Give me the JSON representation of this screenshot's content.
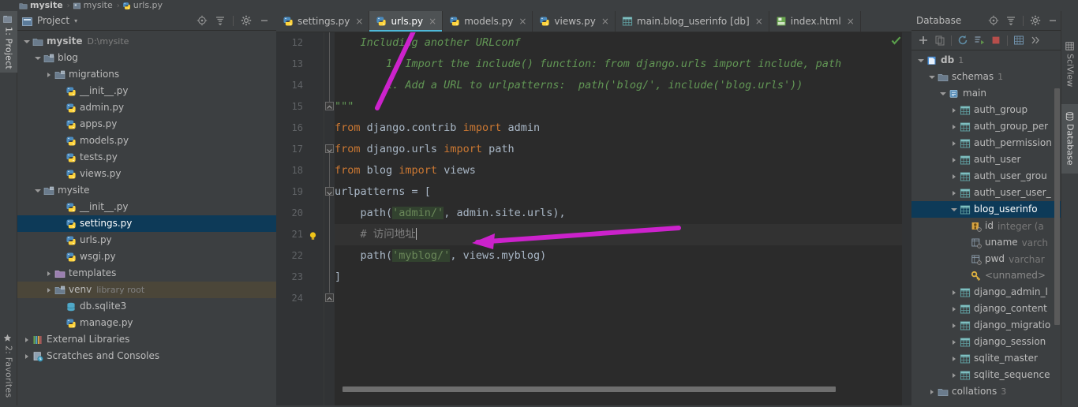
{
  "breadcrumb": {
    "items": [
      {
        "label": "mysite",
        "icon": "folder-icon",
        "bold": true
      },
      {
        "label": "mysite",
        "icon": "module-icon",
        "bold": false
      },
      {
        "label": "urls.py",
        "icon": "python-file-icon",
        "bold": false
      }
    ]
  },
  "left_strip": {
    "tabs": [
      {
        "label": "1: Project",
        "icon": "project-icon",
        "active": true
      },
      {
        "label": "2: Favorites",
        "icon": "star-icon",
        "active": false
      }
    ]
  },
  "right_strip": {
    "tabs": [
      {
        "label": "SciView",
        "icon": "sciview-icon",
        "active": false
      },
      {
        "label": "Database",
        "icon": "database-icon",
        "active": true
      }
    ]
  },
  "project_panel": {
    "title": "Project",
    "dropdown_caret": "▾",
    "tools": [
      "locate-icon",
      "collapse-all-icon",
      "gear-icon",
      "minimize-icon"
    ],
    "tree": [
      {
        "label": "mysite",
        "sub": "D:\\mysite",
        "icon": "folder-icon",
        "indent": 0,
        "arrow": "open",
        "bold": true,
        "state": "normal"
      },
      {
        "label": "blog",
        "sub": "",
        "icon": "module-folder-icon",
        "indent": 1,
        "arrow": "open",
        "bold": false,
        "state": "normal"
      },
      {
        "label": "migrations",
        "sub": "",
        "icon": "module-folder-icon",
        "indent": 2,
        "arrow": "closed",
        "bold": false,
        "state": "normal"
      },
      {
        "label": "__init__.py",
        "sub": "",
        "icon": "python-file-icon",
        "indent": 3,
        "arrow": "none",
        "bold": false,
        "state": "normal"
      },
      {
        "label": "admin.py",
        "sub": "",
        "icon": "python-file-icon",
        "indent": 3,
        "arrow": "none",
        "bold": false,
        "state": "normal"
      },
      {
        "label": "apps.py",
        "sub": "",
        "icon": "python-file-icon",
        "indent": 3,
        "arrow": "none",
        "bold": false,
        "state": "normal"
      },
      {
        "label": "models.py",
        "sub": "",
        "icon": "python-file-icon",
        "indent": 3,
        "arrow": "none",
        "bold": false,
        "state": "normal"
      },
      {
        "label": "tests.py",
        "sub": "",
        "icon": "python-file-icon",
        "indent": 3,
        "arrow": "none",
        "bold": false,
        "state": "normal"
      },
      {
        "label": "views.py",
        "sub": "",
        "icon": "python-file-icon",
        "indent": 3,
        "arrow": "none",
        "bold": false,
        "state": "normal"
      },
      {
        "label": "mysite",
        "sub": "",
        "icon": "module-folder-icon",
        "indent": 1,
        "arrow": "open",
        "bold": false,
        "state": "normal"
      },
      {
        "label": "__init__.py",
        "sub": "",
        "icon": "python-file-icon",
        "indent": 3,
        "arrow": "none",
        "bold": false,
        "state": "normal"
      },
      {
        "label": "settings.py",
        "sub": "",
        "icon": "python-file-icon",
        "indent": 3,
        "arrow": "none",
        "bold": false,
        "state": "selected"
      },
      {
        "label": "urls.py",
        "sub": "",
        "icon": "python-file-icon",
        "indent": 3,
        "arrow": "none",
        "bold": false,
        "state": "normal"
      },
      {
        "label": "wsgi.py",
        "sub": "",
        "icon": "python-file-icon",
        "indent": 3,
        "arrow": "none",
        "bold": false,
        "state": "normal"
      },
      {
        "label": "templates",
        "sub": "",
        "icon": "templates-folder-icon",
        "indent": 2,
        "arrow": "closed",
        "bold": false,
        "state": "normal"
      },
      {
        "label": "venv",
        "sub": "library root",
        "icon": "module-folder-icon",
        "indent": 2,
        "arrow": "closed",
        "bold": false,
        "state": "venv"
      },
      {
        "label": "db.sqlite3",
        "sub": "",
        "icon": "sqlite-file-icon",
        "indent": 3,
        "arrow": "none",
        "bold": false,
        "state": "normal"
      },
      {
        "label": "manage.py",
        "sub": "",
        "icon": "python-file-icon",
        "indent": 3,
        "arrow": "none",
        "bold": false,
        "state": "normal"
      },
      {
        "label": "External Libraries",
        "sub": "",
        "icon": "libraries-icon",
        "indent": 0,
        "arrow": "closed",
        "bold": false,
        "state": "normal"
      },
      {
        "label": "Scratches and Consoles",
        "sub": "",
        "icon": "scratches-icon",
        "indent": 0,
        "arrow": "closed",
        "bold": false,
        "state": "normal"
      }
    ]
  },
  "editor": {
    "tabs": [
      {
        "label": "settings.py",
        "icon": "python-file-icon",
        "active": false,
        "close": "×"
      },
      {
        "label": "urls.py",
        "icon": "python-file-icon",
        "active": true,
        "close": "×"
      },
      {
        "label": "models.py",
        "icon": "python-file-icon",
        "active": false,
        "close": "×"
      },
      {
        "label": "views.py",
        "icon": "python-file-icon",
        "active": false,
        "close": "×"
      },
      {
        "label": "main.blog_userinfo [db]",
        "icon": "table-icon",
        "active": false,
        "close": "×"
      },
      {
        "label": "index.html",
        "icon": "html-file-icon",
        "active": false,
        "close": "×"
      }
    ],
    "line_numbers": [
      "12",
      "13",
      "14",
      "15",
      "16",
      "17",
      "18",
      "19",
      "20",
      "21",
      "22",
      "23",
      "24"
    ],
    "lines": [
      {
        "num": "12",
        "indent": 4,
        "tokens": [
          {
            "t": "Including another URLconf",
            "c": "doc"
          }
        ]
      },
      {
        "num": "13",
        "indent": 8,
        "tokens": [
          {
            "t": "1. Import the include() function: from django.urls import include, path",
            "c": "doc"
          }
        ]
      },
      {
        "num": "14",
        "indent": 8,
        "tokens": [
          {
            "t": "2. Add a URL to urlpatterns:  path('blog/', include('blog.urls'))",
            "c": "doc"
          }
        ]
      },
      {
        "num": "15",
        "indent": 0,
        "tokens": [
          {
            "t": "\"\"\"",
            "c": "doc"
          }
        ]
      },
      {
        "num": "16",
        "indent": 0,
        "tokens": [
          {
            "t": "from",
            "c": "kw"
          },
          {
            "t": " django.contrib ",
            "c": "id"
          },
          {
            "t": "import",
            "c": "kw"
          },
          {
            "t": " admin",
            "c": "id"
          }
        ]
      },
      {
        "num": "17",
        "indent": 0,
        "tokens": [
          {
            "t": "from",
            "c": "kw"
          },
          {
            "t": " django.urls ",
            "c": "id"
          },
          {
            "t": "import",
            "c": "kw"
          },
          {
            "t": " path",
            "c": "id"
          }
        ]
      },
      {
        "num": "18",
        "indent": 0,
        "tokens": [
          {
            "t": "from",
            "c": "kw"
          },
          {
            "t": " blog ",
            "c": "id"
          },
          {
            "t": "import",
            "c": "kw"
          },
          {
            "t": " views",
            "c": "id"
          }
        ]
      },
      {
        "num": "19",
        "indent": 0,
        "tokens": [
          {
            "t": "urlpatterns = [",
            "c": "id"
          }
        ]
      },
      {
        "num": "20",
        "indent": 4,
        "tokens": [
          {
            "t": "path(",
            "c": "id"
          },
          {
            "t": "'admin/'",
            "c": "str"
          },
          {
            "t": ", admin.site.urls),",
            "c": "id"
          }
        ]
      },
      {
        "num": "21",
        "indent": 4,
        "tokens": [
          {
            "t": "# 访问地址",
            "c": "cmt"
          }
        ],
        "caret": true,
        "bulb": true,
        "current": true
      },
      {
        "num": "22",
        "indent": 4,
        "tokens": [
          {
            "t": "path(",
            "c": "id"
          },
          {
            "t": "'myblog/'",
            "c": "str"
          },
          {
            "t": ", views.myblog)",
            "c": "id"
          }
        ]
      },
      {
        "num": "23",
        "indent": 0,
        "tokens": [
          {
            "t": "]",
            "c": "id"
          }
        ]
      },
      {
        "num": "24",
        "indent": 0,
        "tokens": []
      }
    ],
    "inspection_status": "ok-check-icon"
  },
  "database_panel": {
    "title": "Database",
    "head_tools": [
      "locate-icon",
      "collapse-all-icon",
      "gear-icon",
      "minimize-icon"
    ],
    "bar_tools": [
      "add-icon",
      "copy-icon",
      "refresh-icon",
      "run-query-icon",
      "stop-icon",
      "table-view-icon",
      "expand-icon"
    ],
    "tree": [
      {
        "label": "db",
        "sub": "1",
        "icon": "datasource-icon",
        "indent": 0,
        "arrow": "open",
        "bold": true,
        "state": "normal",
        "type": ""
      },
      {
        "label": "schemas",
        "sub": "1",
        "icon": "folder-icon",
        "indent": 1,
        "arrow": "open",
        "bold": false,
        "state": "normal",
        "type": ""
      },
      {
        "label": "main",
        "sub": "",
        "icon": "schema-icon",
        "indent": 2,
        "arrow": "open",
        "bold": false,
        "state": "normal",
        "type": ""
      },
      {
        "label": "auth_group",
        "sub": "",
        "icon": "table-icon",
        "indent": 3,
        "arrow": "closed",
        "bold": false,
        "state": "normal",
        "type": ""
      },
      {
        "label": "auth_group_per",
        "sub": "",
        "icon": "table-icon",
        "indent": 3,
        "arrow": "closed",
        "bold": false,
        "state": "normal",
        "type": ""
      },
      {
        "label": "auth_permission",
        "sub": "",
        "icon": "table-icon",
        "indent": 3,
        "arrow": "closed",
        "bold": false,
        "state": "normal",
        "type": ""
      },
      {
        "label": "auth_user",
        "sub": "",
        "icon": "table-icon",
        "indent": 3,
        "arrow": "closed",
        "bold": false,
        "state": "normal",
        "type": ""
      },
      {
        "label": "auth_user_grou",
        "sub": "",
        "icon": "table-icon",
        "indent": 3,
        "arrow": "closed",
        "bold": false,
        "state": "normal",
        "type": ""
      },
      {
        "label": "auth_user_user_",
        "sub": "",
        "icon": "table-icon",
        "indent": 3,
        "arrow": "closed",
        "bold": false,
        "state": "normal",
        "type": ""
      },
      {
        "label": "blog_userinfo",
        "sub": "",
        "icon": "table-icon",
        "indent": 3,
        "arrow": "open",
        "bold": false,
        "state": "selected",
        "type": ""
      },
      {
        "label": "id",
        "sub": "",
        "icon": "primary-key-column-icon",
        "indent": 4,
        "arrow": "none",
        "bold": false,
        "state": "normal",
        "type": "integer (a"
      },
      {
        "label": "uname",
        "sub": "",
        "icon": "column-icon",
        "indent": 4,
        "arrow": "none",
        "bold": false,
        "state": "normal",
        "type": "varch"
      },
      {
        "label": "pwd",
        "sub": "",
        "icon": "column-icon",
        "indent": 4,
        "arrow": "none",
        "bold": false,
        "state": "normal",
        "type": "varchar"
      },
      {
        "label": "<unnamed>",
        "sub": "",
        "icon": "key-icon",
        "indent": 4,
        "arrow": "none",
        "bold": false,
        "state": "dim",
        "type": ""
      },
      {
        "label": "django_admin_l",
        "sub": "",
        "icon": "table-icon",
        "indent": 3,
        "arrow": "closed",
        "bold": false,
        "state": "normal",
        "type": ""
      },
      {
        "label": "django_content",
        "sub": "",
        "icon": "table-icon",
        "indent": 3,
        "arrow": "closed",
        "bold": false,
        "state": "normal",
        "type": ""
      },
      {
        "label": "django_migratio",
        "sub": "",
        "icon": "table-icon",
        "indent": 3,
        "arrow": "closed",
        "bold": false,
        "state": "normal",
        "type": ""
      },
      {
        "label": "django_session",
        "sub": "",
        "icon": "table-icon",
        "indent": 3,
        "arrow": "closed",
        "bold": false,
        "state": "normal",
        "type": ""
      },
      {
        "label": "sqlite_master",
        "sub": "",
        "icon": "table-icon",
        "indent": 3,
        "arrow": "closed",
        "bold": false,
        "state": "normal",
        "type": ""
      },
      {
        "label": "sqlite_sequence",
        "sub": "",
        "icon": "table-icon",
        "indent": 3,
        "arrow": "closed",
        "bold": false,
        "state": "normal",
        "type": ""
      },
      {
        "label": "collations",
        "sub": "3",
        "icon": "folder-icon",
        "indent": 1,
        "arrow": "closed",
        "bold": false,
        "state": "normal",
        "type": ""
      }
    ]
  },
  "colors": {
    "panel_bg": "#3c3f41",
    "editor_bg": "#2b2b2b",
    "gutter_bg": "#313335",
    "selection_blue": "#0d3a58",
    "accent_cyan": "#4eb8d8",
    "keyword_orange": "#cc7832",
    "string_green": "#6a8759",
    "docstring_green": "#629755",
    "comment_gray": "#808080",
    "annotation_magenta": "#cc22cc"
  }
}
